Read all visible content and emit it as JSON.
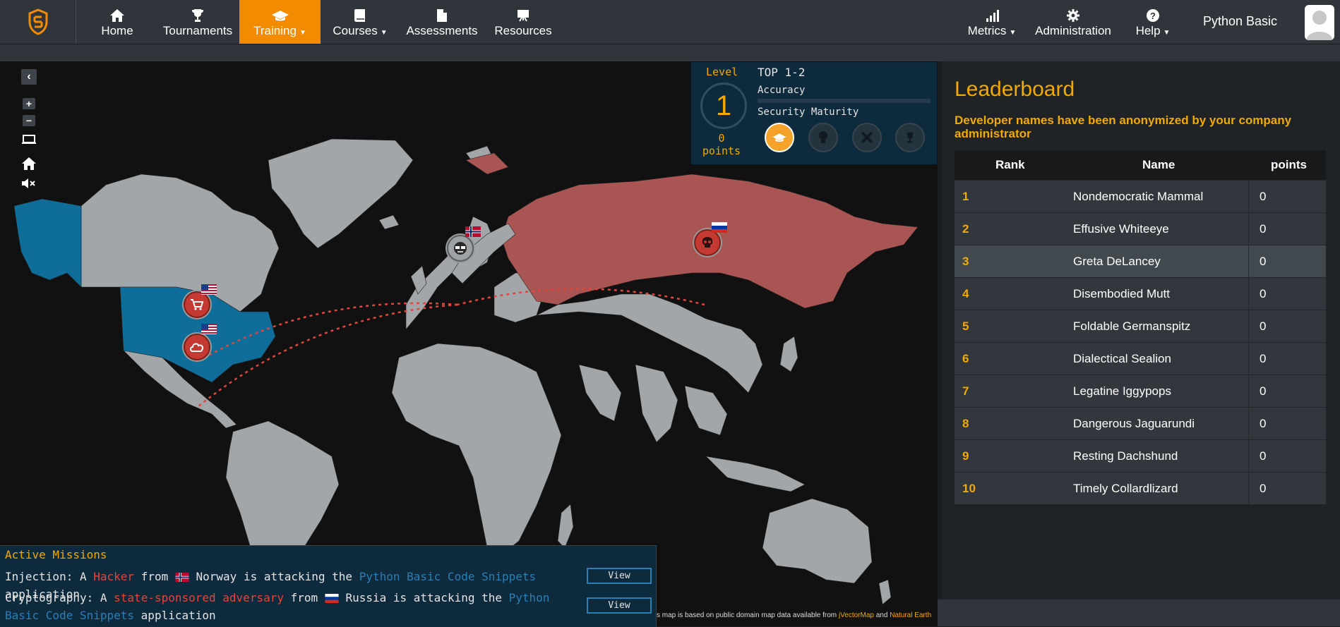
{
  "nav": {
    "items": [
      {
        "label": "Home",
        "icon": "home-icon"
      },
      {
        "label": "Tournaments",
        "icon": "trophy-icon"
      },
      {
        "label": "Training",
        "icon": "graduation-cap-icon",
        "active": true,
        "dropdown": true
      },
      {
        "label": "Courses",
        "icon": "book-icon",
        "dropdown": true
      },
      {
        "label": "Assessments",
        "icon": "document-icon"
      },
      {
        "label": "Resources",
        "icon": "presentation-icon"
      }
    ],
    "right_items": [
      {
        "label": "Metrics",
        "icon": "bar-chart-icon",
        "dropdown": true
      },
      {
        "label": "Administration",
        "icon": "gear-icon"
      },
      {
        "label": "Help",
        "icon": "question-icon",
        "dropdown": true
      }
    ],
    "caret": "▼",
    "user_label": "Python Basic",
    "accent_color": "#f28b00"
  },
  "map": {
    "controls": [
      "collapse-icon",
      "zoom-in-icon",
      "zoom-out-icon",
      "laptop-icon",
      "home-icon",
      "mute-icon"
    ],
    "attribution": {
      "text": "s map is based on public domain map data available from",
      "link1": "jVectorMap",
      "and": "and",
      "link2": "Natural Earth"
    },
    "colors": {
      "attacker_country": "#a85553",
      "target_country": "#0f6d9a",
      "land": "#a3a6a8",
      "ocean": "#111111"
    }
  },
  "level": {
    "label": "Level",
    "value": "1",
    "points_value": "0",
    "points_label": "points",
    "top_label": "TOP 1-2",
    "accuracy_label": "Accuracy",
    "maturity_label": "Security Maturity",
    "accuracy_fraction": 0,
    "badges": [
      {
        "icon": "graduation-cap-icon",
        "active": true
      },
      {
        "icon": "bulb-icon",
        "active": false
      },
      {
        "icon": "tools-icon",
        "active": false
      },
      {
        "icon": "trophy-icon",
        "active": false
      }
    ]
  },
  "missions": {
    "title": "Active Missions",
    "items": [
      {
        "category": "Injection:",
        "a": "A",
        "actor": "Hacker",
        "from": "from",
        "country": "Norway",
        "rest": "is attacking the",
        "app": "Python Basic Code Snippets",
        "tail": "application",
        "button": "View"
      },
      {
        "category": "Cryptography:",
        "a": "A",
        "actor": "state-sponsored adversary",
        "from": "from",
        "country": "Russia",
        "rest": "is attacking the",
        "app": "Python Basic Code Snippets",
        "tail": "application",
        "button": "View"
      }
    ]
  },
  "leaderboard": {
    "title": "Leaderboard",
    "note": "Developer names have been anonymized by your company administrator",
    "columns": [
      "Rank",
      "Name",
      "points"
    ],
    "rows": [
      {
        "rank": "1",
        "name": "Nondemocratic Mammal",
        "points": "0"
      },
      {
        "rank": "2",
        "name": "Effusive Whiteeye",
        "points": "0"
      },
      {
        "rank": "3",
        "name": "Greta DeLancey",
        "points": "0",
        "highlight": true
      },
      {
        "rank": "4",
        "name": "Disembodied Mutt",
        "points": "0"
      },
      {
        "rank": "5",
        "name": "Foldable Germanspitz",
        "points": "0"
      },
      {
        "rank": "6",
        "name": "Dialectical Sealion",
        "points": "0"
      },
      {
        "rank": "7",
        "name": "Legatine Iggypops",
        "points": "0"
      },
      {
        "rank": "8",
        "name": "Dangerous Jaguarundi",
        "points": "0"
      },
      {
        "rank": "9",
        "name": "Resting Dachshund",
        "points": "0"
      },
      {
        "rank": "10",
        "name": "Timely Collardlizard",
        "points": "0"
      }
    ]
  }
}
